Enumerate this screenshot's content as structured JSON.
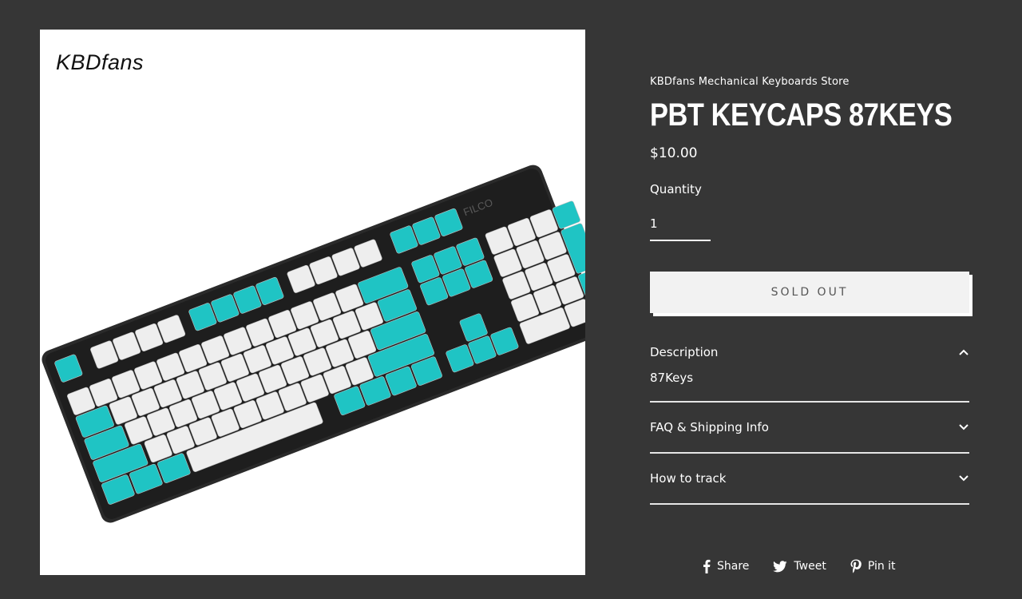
{
  "product_image": {
    "watermark": "KBDfans",
    "alt": "PBT keycaps on a keyboard",
    "keyboard_brand": "FILCO",
    "colors": {
      "accent": "#1fc4c4",
      "light": "#eeeeee",
      "case": "#2a2a2a"
    }
  },
  "product": {
    "vendor": "KBDfans Mechanical Keyboards Store",
    "title": "PBT KEYCAPS 87KEYS",
    "price": "$10.00",
    "quantity_label": "Quantity",
    "quantity_value": "1",
    "sold_out_label": "SOLD OUT"
  },
  "accordion": [
    {
      "title": "Description",
      "icon": "chevron-up-icon",
      "open": true,
      "body": "87Keys"
    },
    {
      "title": "FAQ & Shipping Info",
      "icon": "chevron-down-icon",
      "open": false
    },
    {
      "title": "How to track",
      "icon": "chevron-down-icon",
      "open": false
    }
  ],
  "social": [
    {
      "label": "Share",
      "icon": "facebook-icon"
    },
    {
      "label": "Tweet",
      "icon": "twitter-icon"
    },
    {
      "label": "Pin it",
      "icon": "pinterest-icon"
    }
  ],
  "theme": {
    "background": "#363636",
    "text": "#ffffff",
    "button_bg": "#f2f2f2",
    "button_text": "#555555"
  }
}
